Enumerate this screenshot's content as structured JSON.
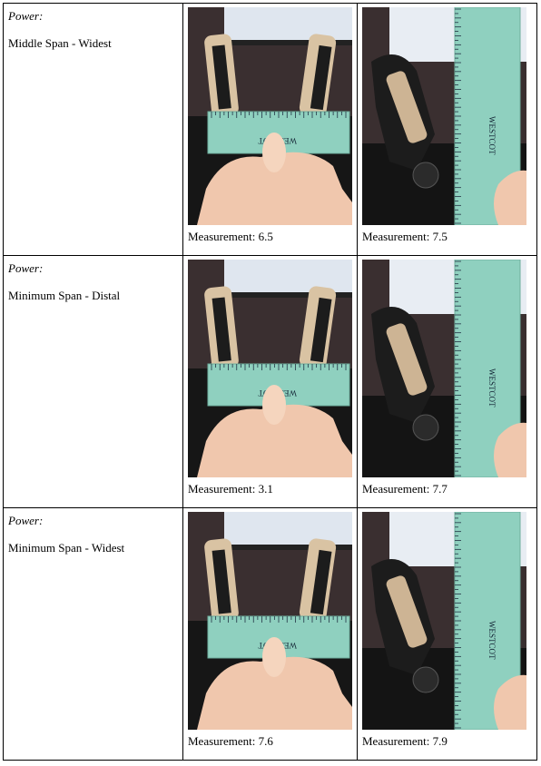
{
  "rows": [
    {
      "category": "Power:",
      "span": "Middle Span - Widest",
      "photos": [
        {
          "measurement_label": "Measurement:",
          "measurement_value": "6.5",
          "ruler_brand": "WESTCOT",
          "ruler_orientation": "horizontal"
        },
        {
          "measurement_label": "Measurement:",
          "measurement_value": "7.5",
          "ruler_brand": "WESTCOT",
          "ruler_orientation": "vertical"
        }
      ]
    },
    {
      "category": "Power:",
      "span": "Minimum Span - Distal",
      "photos": [
        {
          "measurement_label": "Measurement:",
          "measurement_value": "3.1",
          "ruler_brand": "WESTCOT",
          "ruler_orientation": "horizontal"
        },
        {
          "measurement_label": "Measurement:",
          "measurement_value": "7.7",
          "ruler_brand": "WESTCOT",
          "ruler_orientation": "vertical"
        }
      ]
    },
    {
      "category": "Power:",
      "span": "Minimum Span - Widest",
      "photos": [
        {
          "measurement_label": "Measurement:",
          "measurement_value": "7.6",
          "ruler_brand": "WESTCOT",
          "ruler_orientation": "horizontal"
        },
        {
          "measurement_label": "Measurement:",
          "measurement_value": "7.9",
          "ruler_brand": "WESTCOT",
          "ruler_orientation": "vertical"
        }
      ]
    }
  ],
  "colors": {
    "ruler": "#8fd0bf",
    "skin": "#f0c7ad",
    "device": "#1c1c1c",
    "background": "#3a2f30"
  },
  "icons": {
    "photo": "gripper-measurement-photo",
    "ruler": "ruler-icon"
  }
}
